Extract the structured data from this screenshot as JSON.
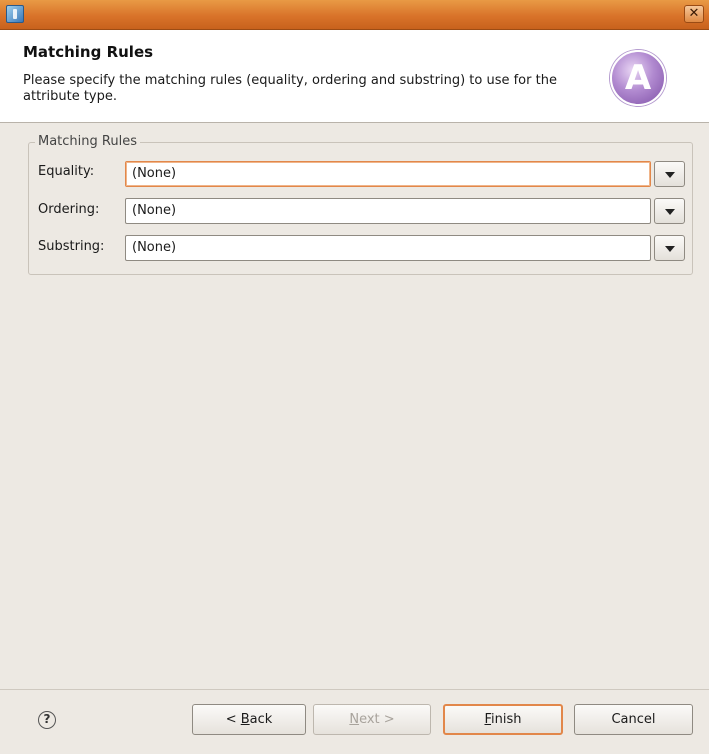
{
  "window": {
    "title_icon": "app-icon",
    "close_icon": "close-icon",
    "close_glyph": "✕"
  },
  "banner": {
    "title": "Matching Rules",
    "description": "Please specify the matching rules (equality, ordering and substring) to use for the attribute type.",
    "logo_letter": "A"
  },
  "group": {
    "legend": "Matching Rules",
    "rows": [
      {
        "label": "Equality:",
        "value": "(None)"
      },
      {
        "label": "Ordering:",
        "value": "(None)"
      },
      {
        "label": "Substring:",
        "value": "(None)"
      }
    ]
  },
  "footer": {
    "help_glyph": "?",
    "back_prefix": "< ",
    "back_mnemonic": "B",
    "back_rest": "ack",
    "next_mnemonic": "N",
    "next_rest": "ext >",
    "finish_mnemonic": "F",
    "finish_rest": "inish",
    "cancel_label": "Cancel"
  },
  "colors": {
    "titlebar": "#d9732a",
    "focus_accent": "#e2874a",
    "logo_purple": "#7e4fa6"
  }
}
